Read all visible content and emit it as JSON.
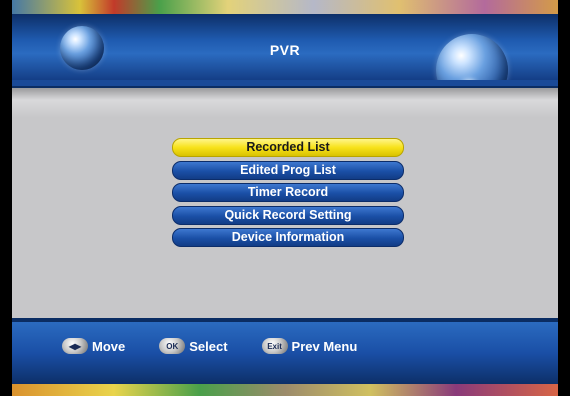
{
  "header": {
    "title": "PVR"
  },
  "menu": {
    "items": [
      {
        "label": "Recorded List",
        "selected": true
      },
      {
        "label": "Edited Prog List",
        "selected": false
      },
      {
        "label": "Timer Record",
        "selected": false
      },
      {
        "label": "Quick Record Setting",
        "selected": false
      },
      {
        "label": "Device Information",
        "selected": false
      }
    ]
  },
  "footer": {
    "hints": [
      {
        "icon": "move-arrows-icon",
        "icon_text": "◀▶",
        "label": "Move"
      },
      {
        "icon": "ok-icon",
        "icon_text": "OK",
        "label": "Select"
      },
      {
        "icon": "exit-icon",
        "icon_text": "Exit",
        "label": "Prev Menu"
      }
    ]
  },
  "colors": {
    "accent_blue": "#1a4fa6",
    "selected_yellow": "#f7e21a",
    "screen_gray": "#c7c7c9"
  }
}
